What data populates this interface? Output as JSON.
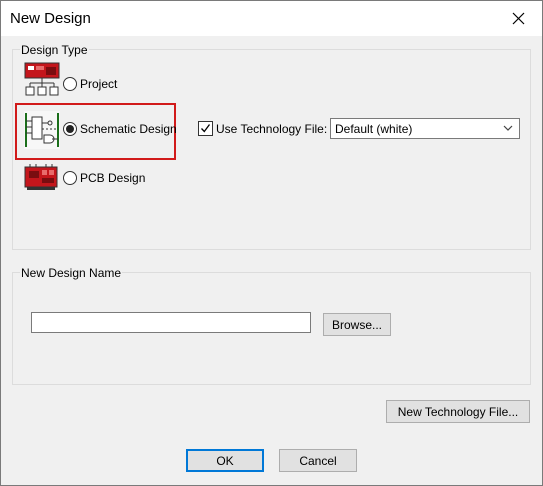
{
  "window": {
    "title": "New Design"
  },
  "design_type": {
    "group_label": "Design Type",
    "options": [
      {
        "label": "Project",
        "checked": false,
        "icon": "project-icon"
      },
      {
        "label": "Schematic Design",
        "checked": true,
        "icon": "schematic-icon"
      },
      {
        "label": "PCB Design",
        "checked": false,
        "icon": "pcb-icon"
      }
    ],
    "use_technology_file": {
      "label": "Use Technology File:",
      "checked": true
    },
    "technology_select": {
      "value": "Default (white)"
    }
  },
  "design_name": {
    "group_label": "New Design Name",
    "input_value": "",
    "browse_label": "Browse..."
  },
  "buttons": {
    "new_technology_file": "New Technology File...",
    "ok": "OK",
    "cancel": "Cancel"
  },
  "colors": {
    "highlight_border": "#d11a1a",
    "default_button_border": "#0078d7"
  }
}
